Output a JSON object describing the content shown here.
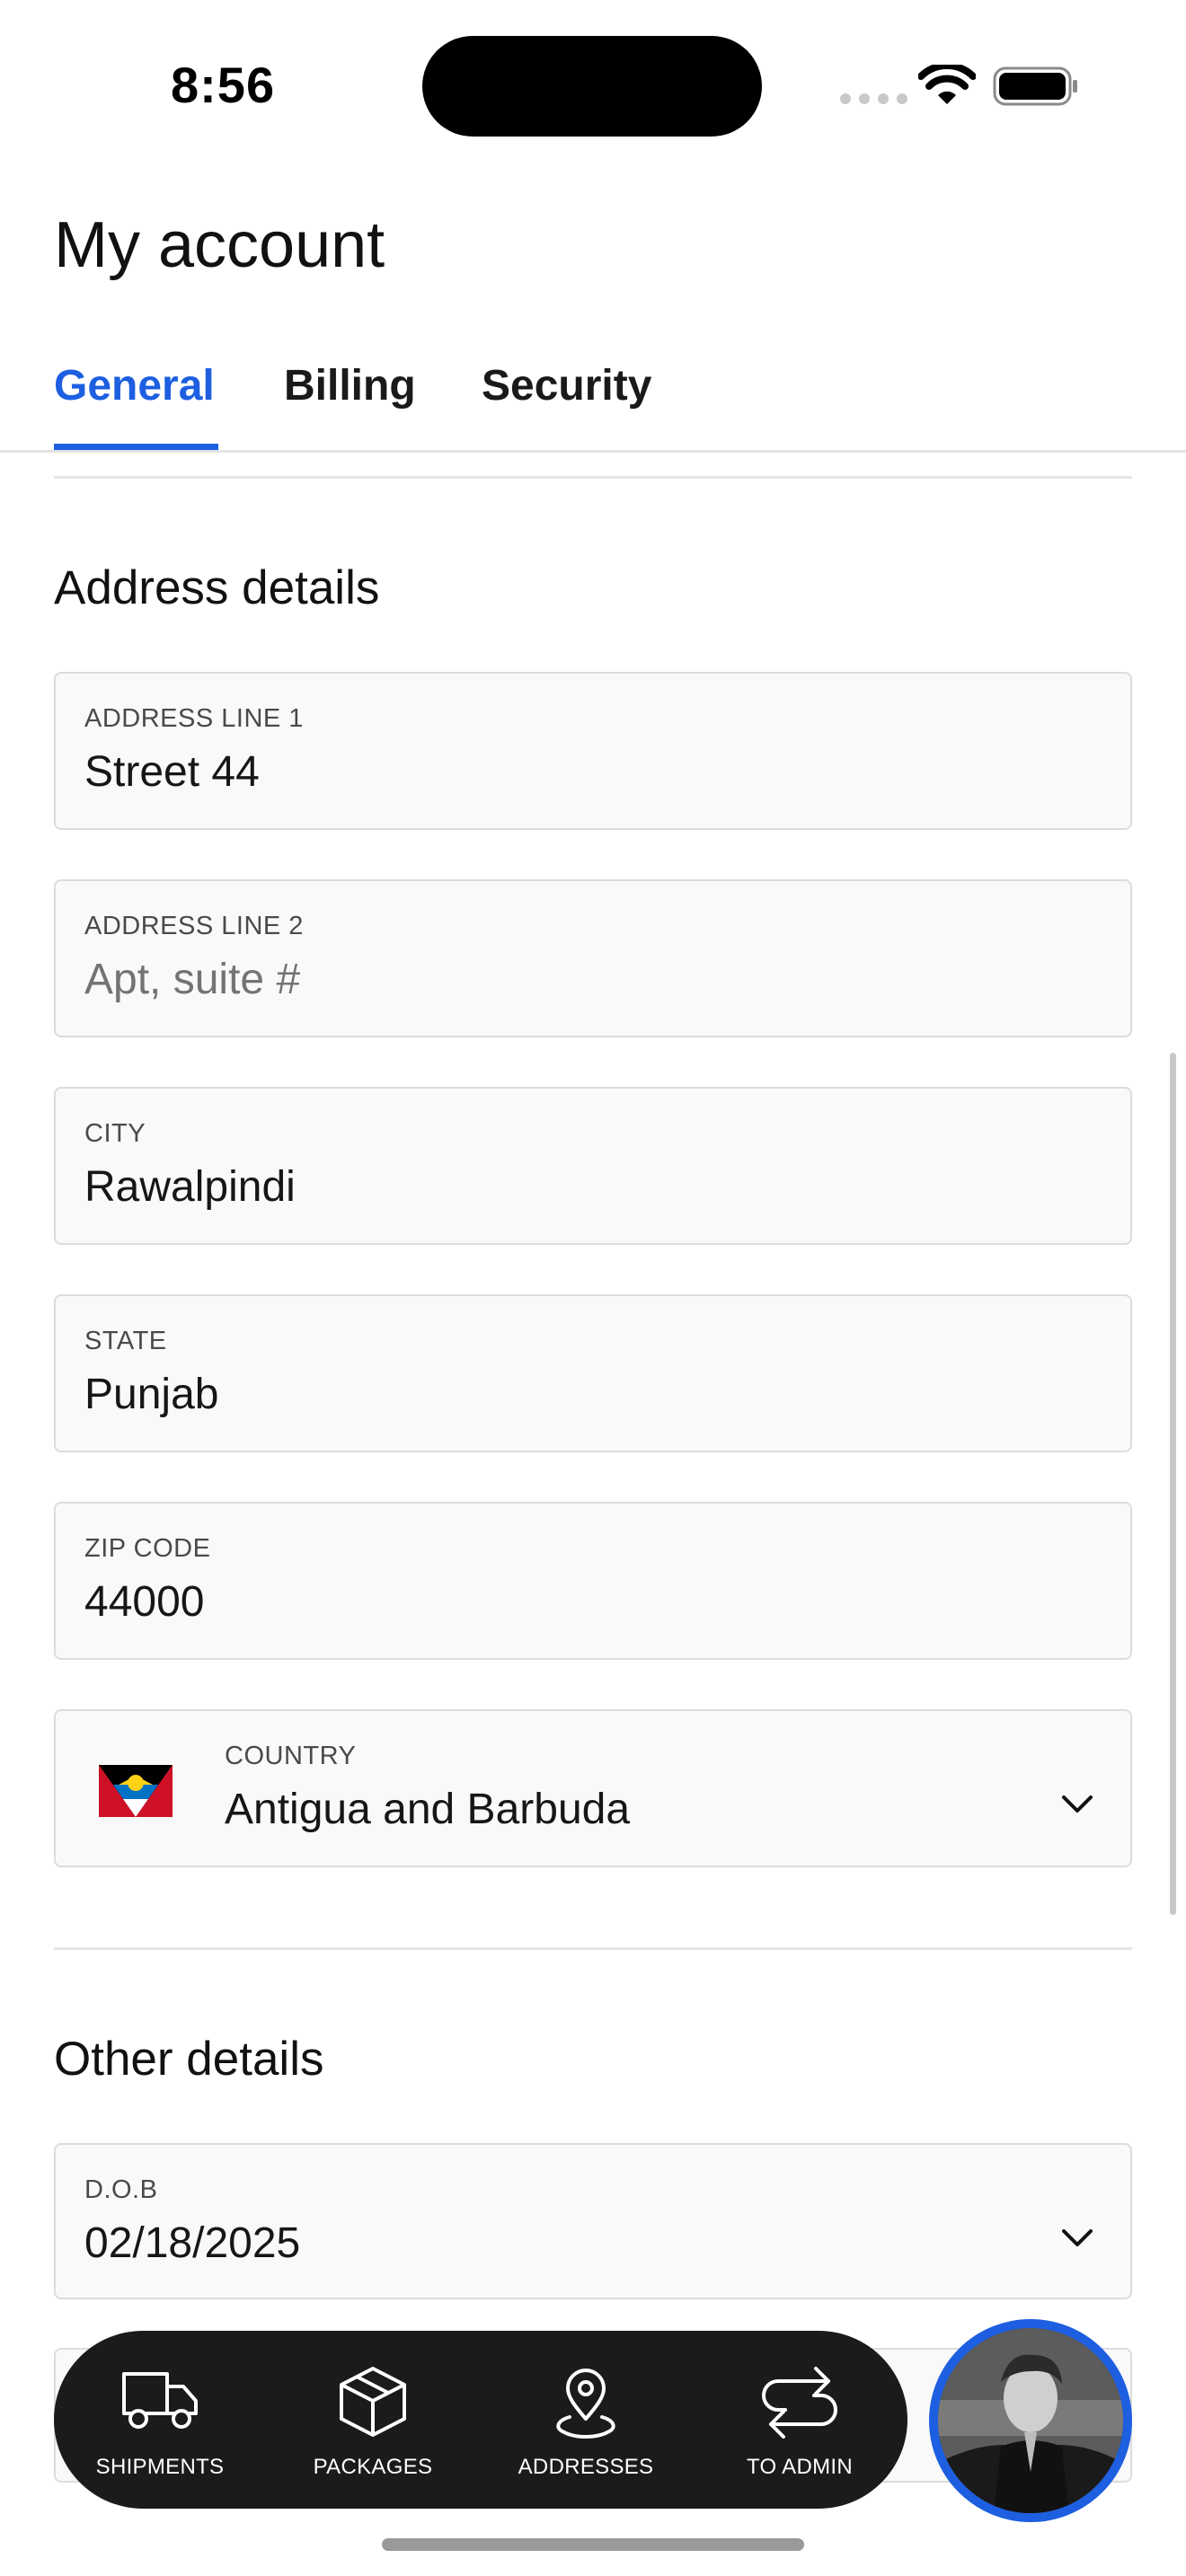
{
  "status_bar": {
    "time": "8:56"
  },
  "header": {
    "title": "My account",
    "tabs": [
      {
        "label": "General",
        "active": true
      },
      {
        "label": "Billing",
        "active": false
      },
      {
        "label": "Security",
        "active": false
      }
    ]
  },
  "address_section": {
    "title": "Address details",
    "fields": [
      {
        "label": "ADDRESS LINE 1",
        "value": "Street 44",
        "placeholder": ""
      },
      {
        "label": "ADDRESS LINE 2",
        "value": "",
        "placeholder": "Apt, suite #"
      },
      {
        "label": "CITY",
        "value": "Rawalpindi"
      },
      {
        "label": "STATE",
        "value": "Punjab"
      },
      {
        "label": "ZIP CODE",
        "value": "44000"
      }
    ],
    "country": {
      "label": "COUNTRY",
      "value": "Antigua and Barbuda",
      "flag_icon": "antigua-and-barbuda-flag-icon"
    }
  },
  "other_section": {
    "title": "Other details",
    "dob": {
      "label": "D.O.B",
      "value": "02/18/2025"
    }
  },
  "bottom_nav": {
    "items": [
      {
        "label": "SHIPMENTS",
        "icon": "truck-icon"
      },
      {
        "label": "PACKAGES",
        "icon": "package-icon"
      },
      {
        "label": "ADDRESSES",
        "icon": "location-pin-icon"
      },
      {
        "label": "TO ADMIN",
        "icon": "swap-arrows-icon"
      }
    ]
  },
  "colors": {
    "accent": "#1d5fe0",
    "nav_background": "#1b1b1b",
    "field_background": "#f9f9f9",
    "field_border": "#dcdcdc"
  }
}
